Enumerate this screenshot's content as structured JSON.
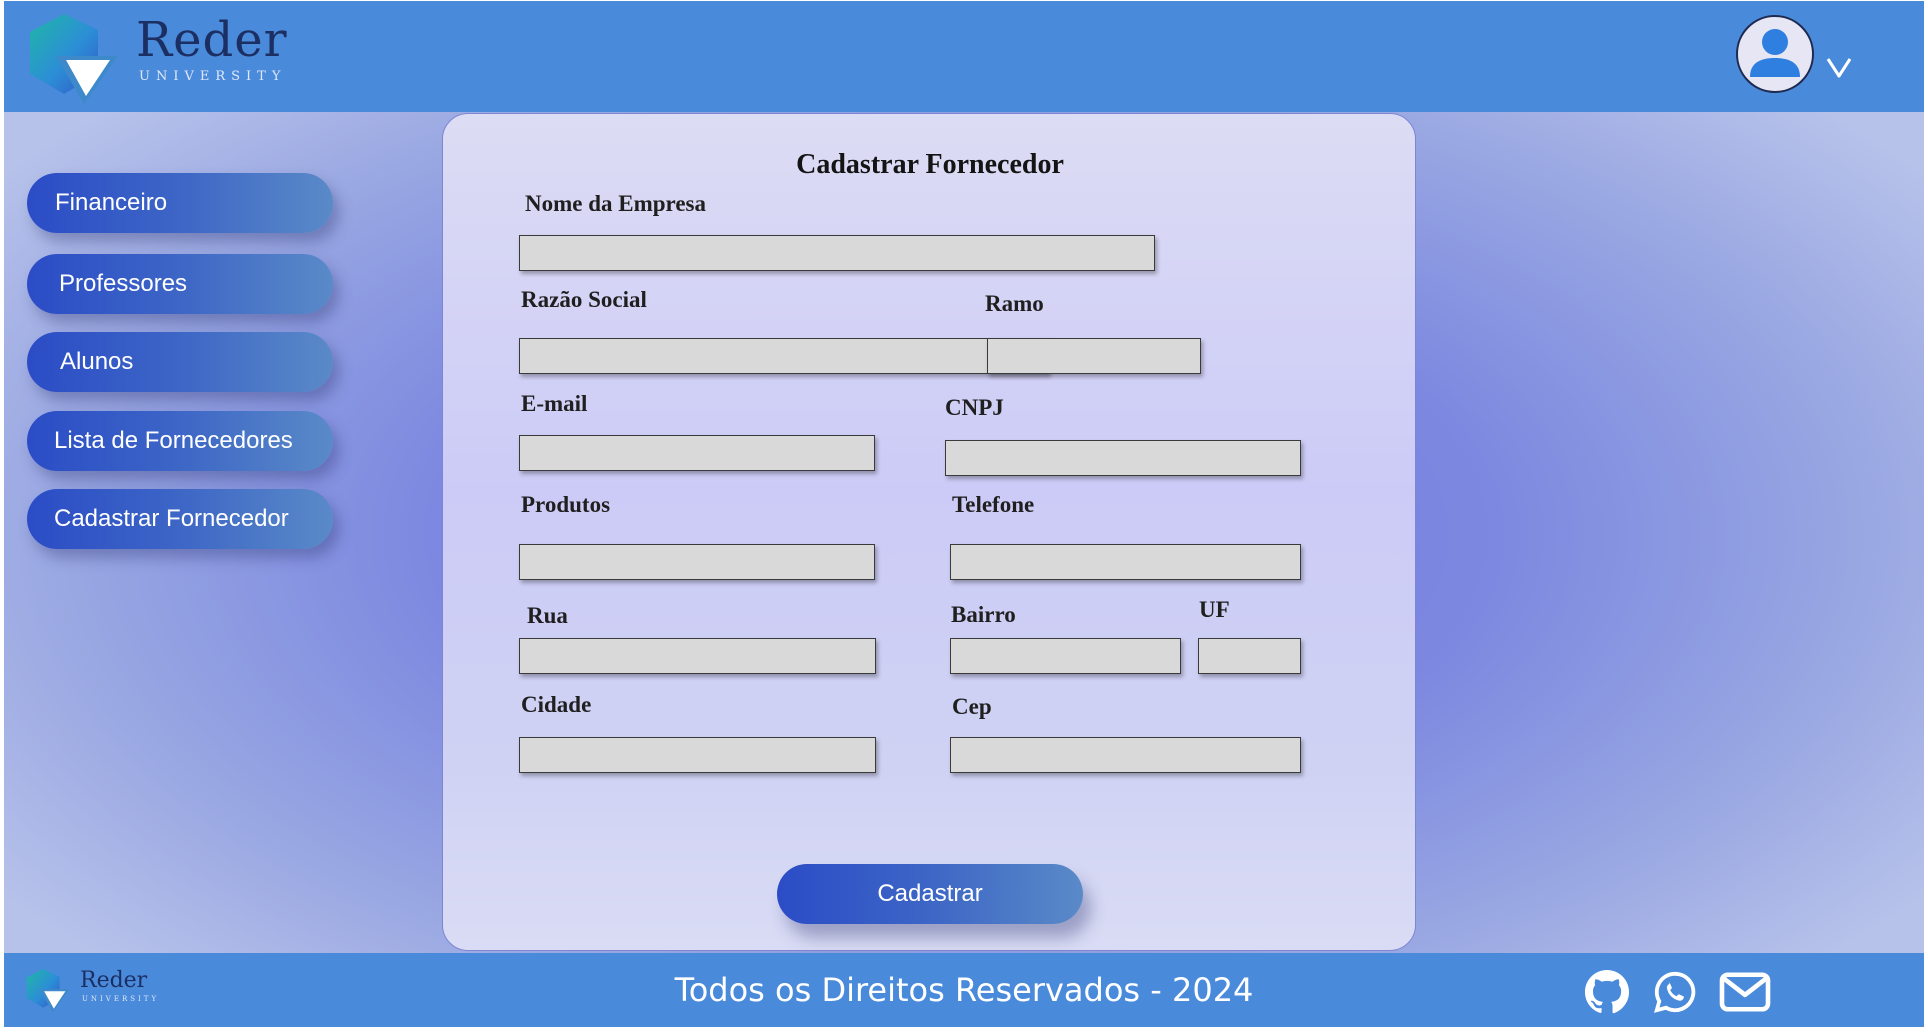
{
  "header": {
    "logo_text": "Reder",
    "logo_subtext": "UNIVERSITY",
    "user_icon": "user-icon",
    "menu_icon": "chevron-down-icon"
  },
  "sidebar": {
    "items": [
      {
        "label": "Financeiro"
      },
      {
        "label": "Professores"
      },
      {
        "label": "Alunos"
      },
      {
        "label": "Lista de Fornecedores"
      },
      {
        "label": "Cadastrar Fornecedor"
      }
    ]
  },
  "form": {
    "title": "Cadastrar Fornecedor",
    "fields": {
      "nome_empresa": {
        "label": "Nome da Empresa",
        "value": ""
      },
      "razao_social": {
        "label": "Razão Social",
        "value": ""
      },
      "ramo": {
        "label": "Ramo",
        "value": ""
      },
      "email": {
        "label": "E-mail",
        "value": ""
      },
      "cnpj": {
        "label": "CNPJ",
        "value": ""
      },
      "produtos": {
        "label": "Produtos",
        "value": ""
      },
      "telefone": {
        "label": "Telefone",
        "value": ""
      },
      "rua": {
        "label": "Rua",
        "value": ""
      },
      "bairro": {
        "label": "Bairro",
        "value": ""
      },
      "uf": {
        "label": "UF",
        "value": ""
      },
      "cidade": {
        "label": "Cidade",
        "value": ""
      },
      "cep": {
        "label": "Cep",
        "value": ""
      }
    },
    "submit_label": "Cadastrar"
  },
  "footer": {
    "logo_text": "Reder",
    "logo_subtext": "UNIVERSITY",
    "copyright": "Todos os Direitos Reservados - 2024",
    "icons": [
      "github-icon",
      "whatsapp-icon",
      "mail-icon"
    ]
  },
  "colors": {
    "header_bg": "#4a8adb",
    "button_gradient_start": "#2b4cc6",
    "button_gradient_end": "#5a8ac8",
    "input_bg": "#d9d9d9",
    "card_bg": "#cccbf7"
  }
}
